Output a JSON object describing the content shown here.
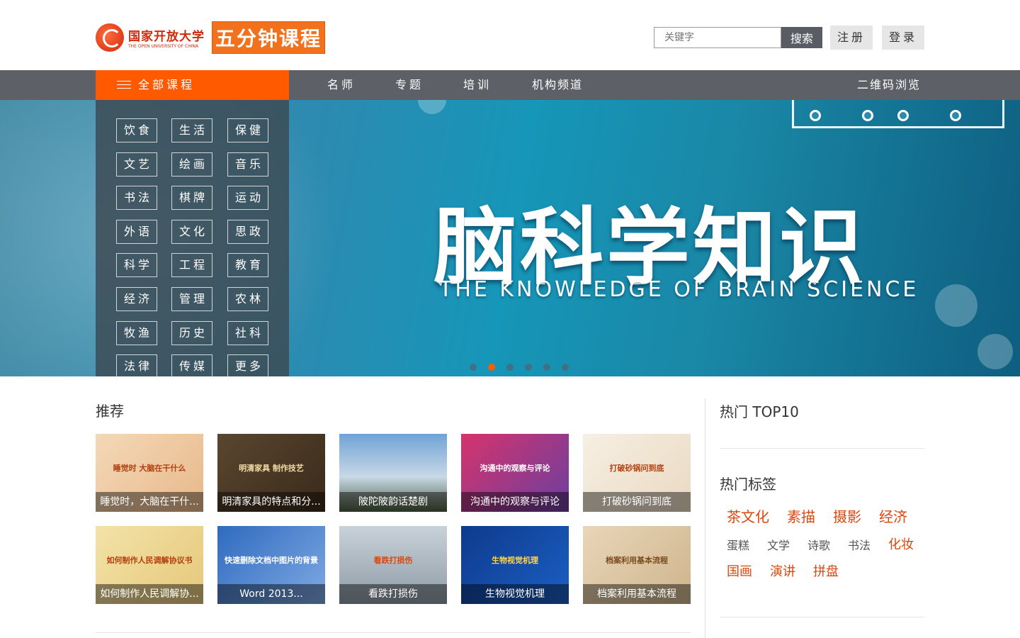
{
  "header": {
    "logo_cn": "国家开放大学",
    "logo_en": "THE OPEN UNIVERSITY OF CHINA",
    "logo_course": "五分钟课程",
    "search_placeholder": "关键字",
    "search_button": "搜索",
    "register": "注册",
    "login": "登录"
  },
  "nav": {
    "all_courses": "全部课程",
    "items": [
      "名师",
      "专题",
      "培训",
      "机构频道"
    ],
    "qr": "二维码浏览"
  },
  "categories": [
    "饮食",
    "生活",
    "保健",
    "文艺",
    "绘画",
    "音乐",
    "书法",
    "棋牌",
    "运动",
    "外语",
    "文化",
    "思政",
    "科学",
    "工程",
    "教育",
    "经济",
    "管理",
    "农林",
    "牧渔",
    "历史",
    "社科",
    "法律",
    "传媒",
    "更多"
  ],
  "banner": {
    "title": "脑科学知识",
    "subtitle": "THE KNOWLEDGE OF BRAIN SCIENCE",
    "slides": 6,
    "active_slide": 2
  },
  "recommend": {
    "heading": "推荐",
    "items": [
      {
        "caption": "睡觉时，大脑在干什...",
        "thumb_text": "睡觉时 大脑在干什么"
      },
      {
        "caption": "明清家具的特点和分...",
        "thumb_text": "明清家具 制作技艺"
      },
      {
        "caption": "陂陀陂韵话楚剧",
        "thumb_text": ""
      },
      {
        "caption": "沟通中的观察与评论",
        "thumb_text": "沟通中的观察与评论"
      },
      {
        "caption": "打破砂锅问到底",
        "thumb_text": "打破砂锅问到底"
      },
      {
        "caption": "如何制作人民调解协...",
        "thumb_text": "如何制作人民调解协议书"
      },
      {
        "caption": "Word 2013...",
        "thumb_text": "快速删除文档中图片的背景"
      },
      {
        "caption": "看跌打损伤",
        "thumb_text": "看跌打损伤"
      },
      {
        "caption": "生物视觉机理",
        "thumb_text": "生物视觉机理"
      },
      {
        "caption": "档案利用基本流程",
        "thumb_text": "档案利用基本流程"
      }
    ]
  },
  "sidebar": {
    "top10_heading": "热门 TOP10",
    "tags_heading": "热门标签",
    "tags": [
      "茶文化",
      "素描",
      "摄影",
      "经济",
      "蛋糕",
      "文学",
      "诗歌",
      "书法",
      "化妆",
      "国画",
      "演讲",
      "拼盘"
    ]
  },
  "colors": {
    "accent": "#ff5a00",
    "nav_bg": "#5d6066",
    "tag_red": "#d9480f"
  }
}
